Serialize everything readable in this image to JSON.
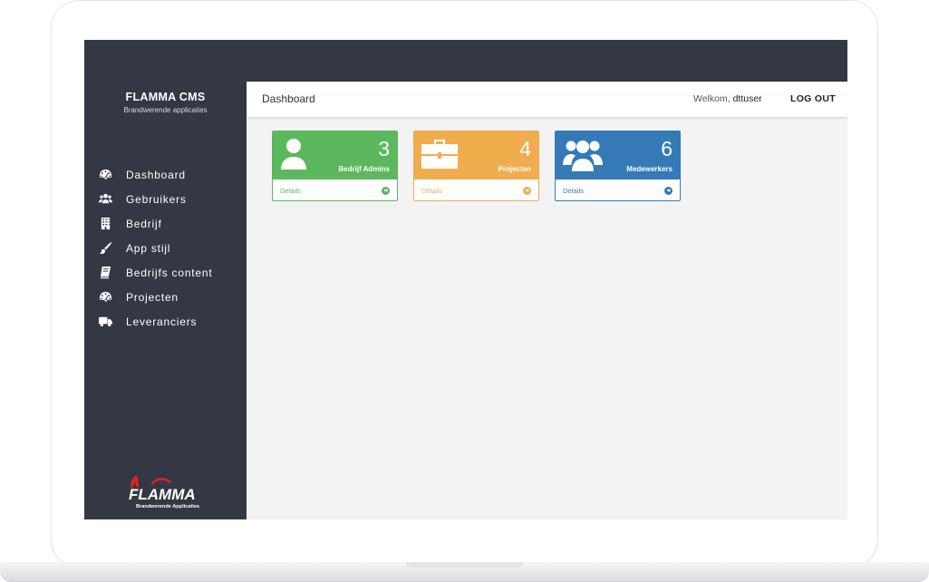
{
  "app": {
    "brand_title": "FLAMMA CMS",
    "brand_subtitle": "Brandwerende applicaties",
    "logo_text": "FLAMMA",
    "logo_subtext": "Brandwerende Applicaties"
  },
  "sidebar": {
    "items": [
      {
        "label": "Dashboard",
        "icon": "dashboard-icon"
      },
      {
        "label": "Gebruikers",
        "icon": "users-icon"
      },
      {
        "label": "Bedrijf",
        "icon": "building-icon"
      },
      {
        "label": "App stijl",
        "icon": "paintbrush-icon"
      },
      {
        "label": "Bedrijfs content",
        "icon": "book-icon"
      },
      {
        "label": "Projecten",
        "icon": "dashboard-icon"
      },
      {
        "label": "Leveranciers",
        "icon": "truck-icon"
      }
    ]
  },
  "header": {
    "title": "Dashboard",
    "welcome_prefix": "Welkom,",
    "username": "dttuser",
    "logout_label": "LOG OUT"
  },
  "cards": [
    {
      "count": "3",
      "label": "Bedrijf Admins",
      "footer": "Details",
      "icon": "user-icon",
      "color": "#5cb85c"
    },
    {
      "count": "4",
      "label": "Projecten",
      "footer": "Details",
      "icon": "briefcase-icon",
      "color": "#f0ad4e"
    },
    {
      "count": "6",
      "label": "Medewerkers",
      "footer": "Details",
      "icon": "group-icon",
      "color": "#337ab7"
    }
  ],
  "colors": {
    "sidebar": "#333844",
    "content_bg": "#f3f3f4",
    "accent_red": "#e2231a"
  }
}
